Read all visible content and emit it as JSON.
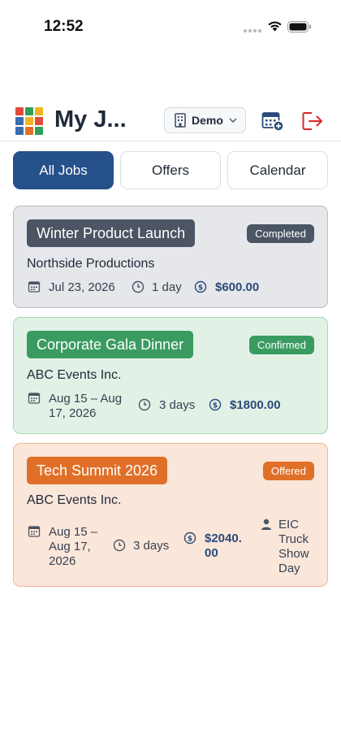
{
  "status_bar": {
    "time": "12:52"
  },
  "header": {
    "title": "My J...",
    "org_select": "Demo",
    "logo_colors": [
      "#e04a3a",
      "#2f9e58",
      "#f0b323",
      "#3a6bb0",
      "#f0b323",
      "#e04a3a",
      "#3a6bb0",
      "#e07028",
      "#2f9e58"
    ]
  },
  "tabs": [
    {
      "label": "All Jobs",
      "active": true
    },
    {
      "label": "Offers",
      "active": false
    },
    {
      "label": "Calendar",
      "active": false
    }
  ],
  "jobs": [
    {
      "title": "Winter Product Launch",
      "status": "Completed",
      "client": "Northside Productions",
      "date": "Jul 23, 2026",
      "duration": "1 day",
      "price": "$600.00",
      "color": "#4b5563"
    },
    {
      "title": "Corporate Gala Dinner",
      "status": "Confirmed",
      "client": "ABC Events Inc.",
      "date_line1": "Aug 15 – Aug",
      "date_line2": "17, 2026",
      "duration": "3 days",
      "price": "$1800.00",
      "color": "#3a9b61"
    },
    {
      "title": "Tech Summit 2026",
      "status": "Offered",
      "client": "ABC Events Inc.",
      "date_line1": "Aug 15 –",
      "date_line2": "Aug 17,",
      "date_line3": "2026",
      "duration": "3 days",
      "price_line1": "$2040.",
      "price_line2": "00",
      "role_line1": "EIC",
      "role_line2": "Truck",
      "role_line3": "Show",
      "role_line4": "Day",
      "color": "#e07028"
    }
  ]
}
